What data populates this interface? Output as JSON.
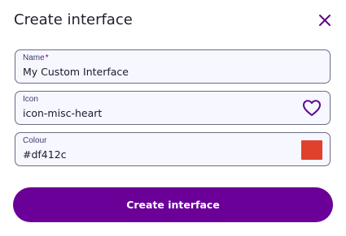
{
  "dialog": {
    "title": "Create interface",
    "close_icon": "close-icon"
  },
  "fields": {
    "name": {
      "label": "Name",
      "required_marker": "*",
      "value": "My Custom Interface"
    },
    "icon": {
      "label": "Icon",
      "value": "icon-misc-heart",
      "preview_icon": "heart-icon"
    },
    "colour": {
      "label": "Colour",
      "value": "#df412c",
      "swatch_color": "#df412c"
    }
  },
  "actions": {
    "create_label": "Create interface"
  },
  "colors": {
    "accent": "#6a0097",
    "icon_accent": "#5d0a86",
    "field_background": "#f6f7ff",
    "field_border": "#6d6b86"
  }
}
